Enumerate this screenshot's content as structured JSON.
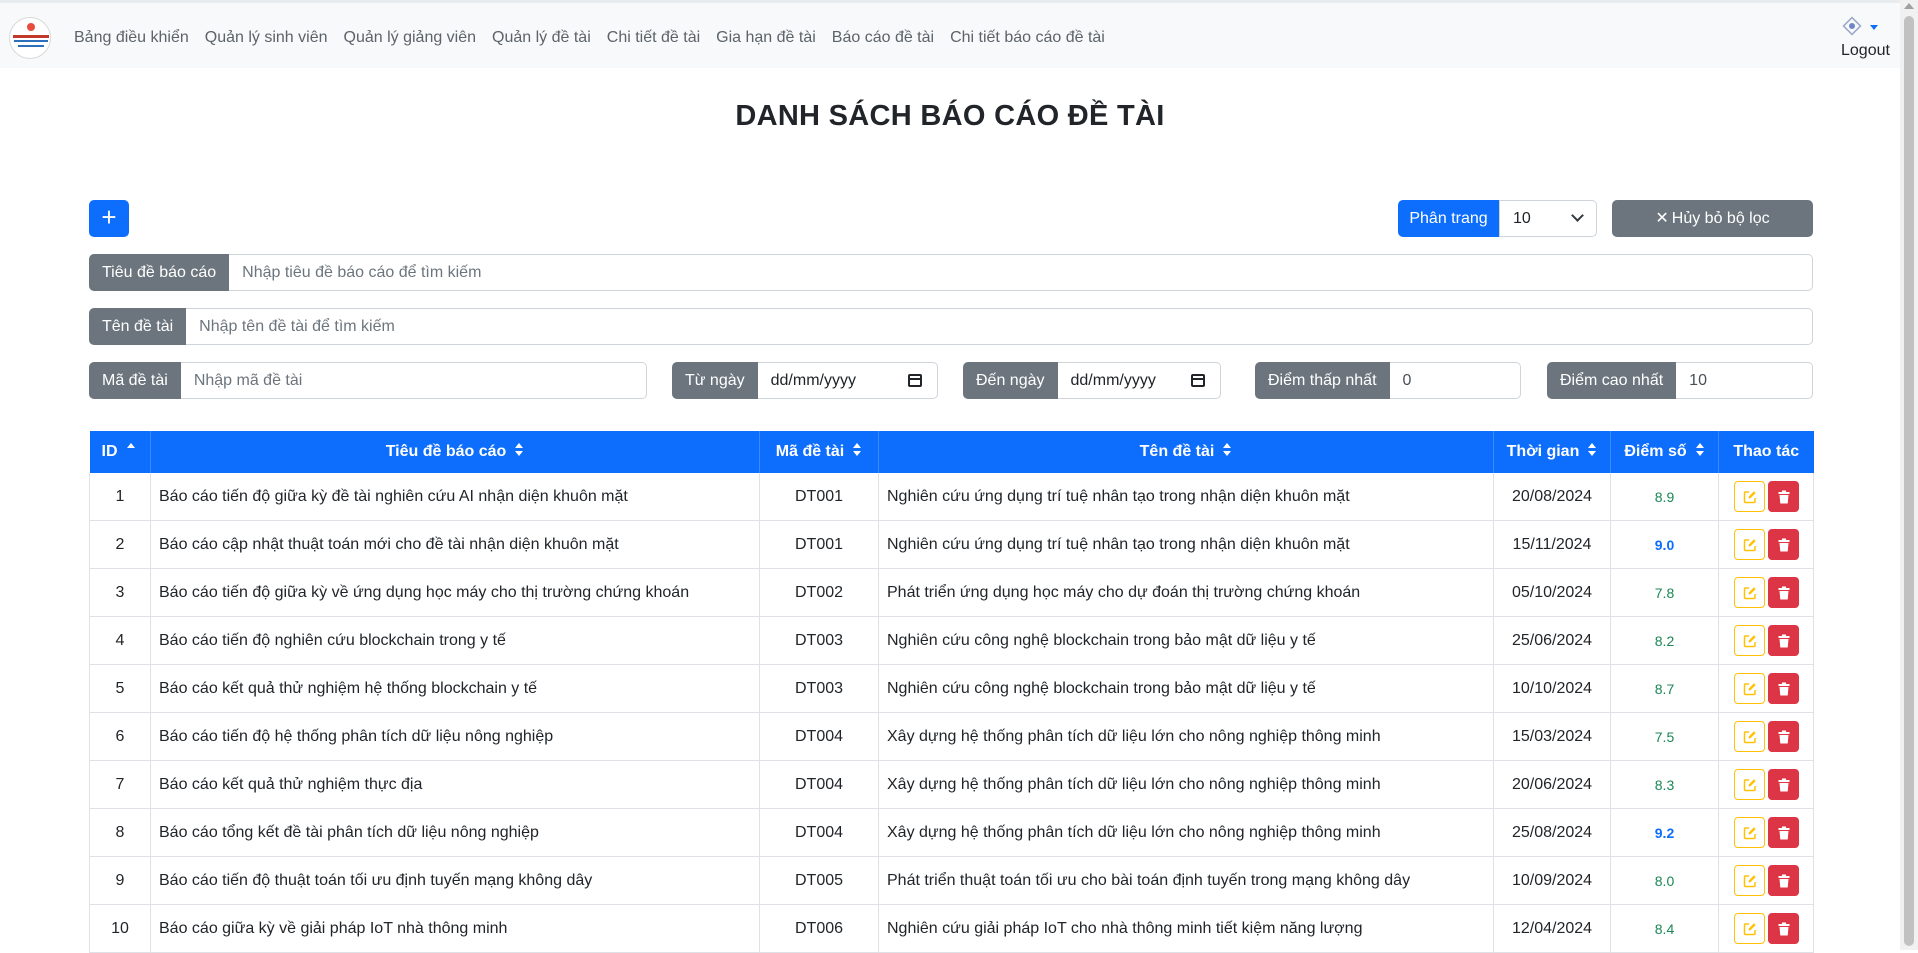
{
  "nav": {
    "items": [
      {
        "label": "Bảng điều khiển"
      },
      {
        "label": "Quản lý sinh viên"
      },
      {
        "label": "Quản lý giảng viên"
      },
      {
        "label": "Quản lý đề tài"
      },
      {
        "label": "Chi tiết đề tài"
      },
      {
        "label": "Gia hạn đề tài"
      },
      {
        "label": "Báo cáo đề tài"
      },
      {
        "label": "Chi tiết báo cáo đề tài"
      }
    ],
    "logout": "Logout"
  },
  "page_title": "DANH SÁCH BÁO CÁO ĐỀ TÀI",
  "toolbar": {
    "add_label": "+",
    "pagination_label": "Phân trang",
    "pagination_value": "10",
    "clear_label": "Hủy bỏ bộ lọc"
  },
  "filters": {
    "title": {
      "label": "Tiêu đề báo cáo",
      "placeholder": "Nhập tiêu đề báo cáo để tìm kiếm"
    },
    "topic_name": {
      "label": "Tên đề tài",
      "placeholder": "Nhập tên đề tài để tìm kiếm"
    },
    "topic_code": {
      "label": "Mã đề tài",
      "placeholder": "Nhập mã đề tài"
    },
    "from_date": {
      "label": "Từ ngày",
      "value": "dd/mm/yyyy"
    },
    "to_date": {
      "label": "Đến ngày",
      "value": "dd/mm/yyyy"
    },
    "min_score": {
      "label": "Điểm thấp nhất",
      "value": "0"
    },
    "max_score": {
      "label": "Điểm cao nhất",
      "value": "10"
    }
  },
  "table": {
    "headers": {
      "id": "ID",
      "title": "Tiêu đề báo cáo",
      "code": "Mã đề tài",
      "topic": "Tên đề tài",
      "time": "Thời gian",
      "score": "Điểm số",
      "actions": "Thao tác"
    },
    "rows": [
      {
        "id": "1",
        "title": "Báo cáo tiến độ giữa kỳ đề tài nghiên cứu AI nhận diện khuôn mặt",
        "code": "DT001",
        "topic": "Nghiên cứu ứng dụng trí tuệ nhân tạo trong nhận diện khuôn mặt",
        "time": "20/08/2024",
        "score": "8.9"
      },
      {
        "id": "2",
        "title": "Báo cáo cập nhật thuật toán mới cho đề tài nhận diện khuôn mặt",
        "code": "DT001",
        "topic": "Nghiên cứu ứng dụng trí tuệ nhân tạo trong nhận diện khuôn mặt",
        "time": "15/11/2024",
        "score": "9.0"
      },
      {
        "id": "3",
        "title": "Báo cáo tiến độ giữa kỳ về ứng dụng học máy cho thị trường chứng khoán",
        "code": "DT002",
        "topic": "Phát triển ứng dụng học máy cho dự đoán thị trường chứng khoán",
        "time": "05/10/2024",
        "score": "7.8"
      },
      {
        "id": "4",
        "title": "Báo cáo tiến độ nghiên cứu blockchain trong y tế",
        "code": "DT003",
        "topic": "Nghiên cứu công nghệ blockchain trong bảo mật dữ liệu y tế",
        "time": "25/06/2024",
        "score": "8.2"
      },
      {
        "id": "5",
        "title": "Báo cáo kết quả thử nghiệm hệ thống blockchain y tế",
        "code": "DT003",
        "topic": "Nghiên cứu công nghệ blockchain trong bảo mật dữ liệu y tế",
        "time": "10/10/2024",
        "score": "8.7"
      },
      {
        "id": "6",
        "title": "Báo cáo tiến độ hệ thống phân tích dữ liệu nông nghiệp",
        "code": "DT004",
        "topic": "Xây dựng hệ thống phân tích dữ liệu lớn cho nông nghiệp thông minh",
        "time": "15/03/2024",
        "score": "7.5"
      },
      {
        "id": "7",
        "title": "Báo cáo kết quả thử nghiệm thực địa",
        "code": "DT004",
        "topic": "Xây dựng hệ thống phân tích dữ liệu lớn cho nông nghiệp thông minh",
        "time": "20/06/2024",
        "score": "8.3"
      },
      {
        "id": "8",
        "title": "Báo cáo tổng kết đề tài phân tích dữ liệu nông nghiệp",
        "code": "DT004",
        "topic": "Xây dựng hệ thống phân tích dữ liệu lớn cho nông nghiệp thông minh",
        "time": "25/08/2024",
        "score": "9.2"
      },
      {
        "id": "9",
        "title": "Báo cáo tiến độ thuật toán tối ưu định tuyến mạng không dây",
        "code": "DT005",
        "topic": "Phát triển thuật toán tối ưu cho bài toán định tuyến trong mạng không dây",
        "time": "10/09/2024",
        "score": "8.0"
      },
      {
        "id": "10",
        "title": "Báo cáo giữa kỳ về giải pháp IoT nhà thông minh",
        "code": "DT006",
        "topic": "Nghiên cứu giải pháp IoT cho nhà thông minh tiết kiệm năng lượng",
        "time": "12/04/2024",
        "score": "8.4"
      }
    ]
  },
  "colors": {
    "primary": "#0d6efd",
    "secondary": "#6c757d",
    "score_normal": "#198754",
    "score_high": "#0d6efd",
    "danger": "#dc3545",
    "warning": "#ffc107"
  }
}
